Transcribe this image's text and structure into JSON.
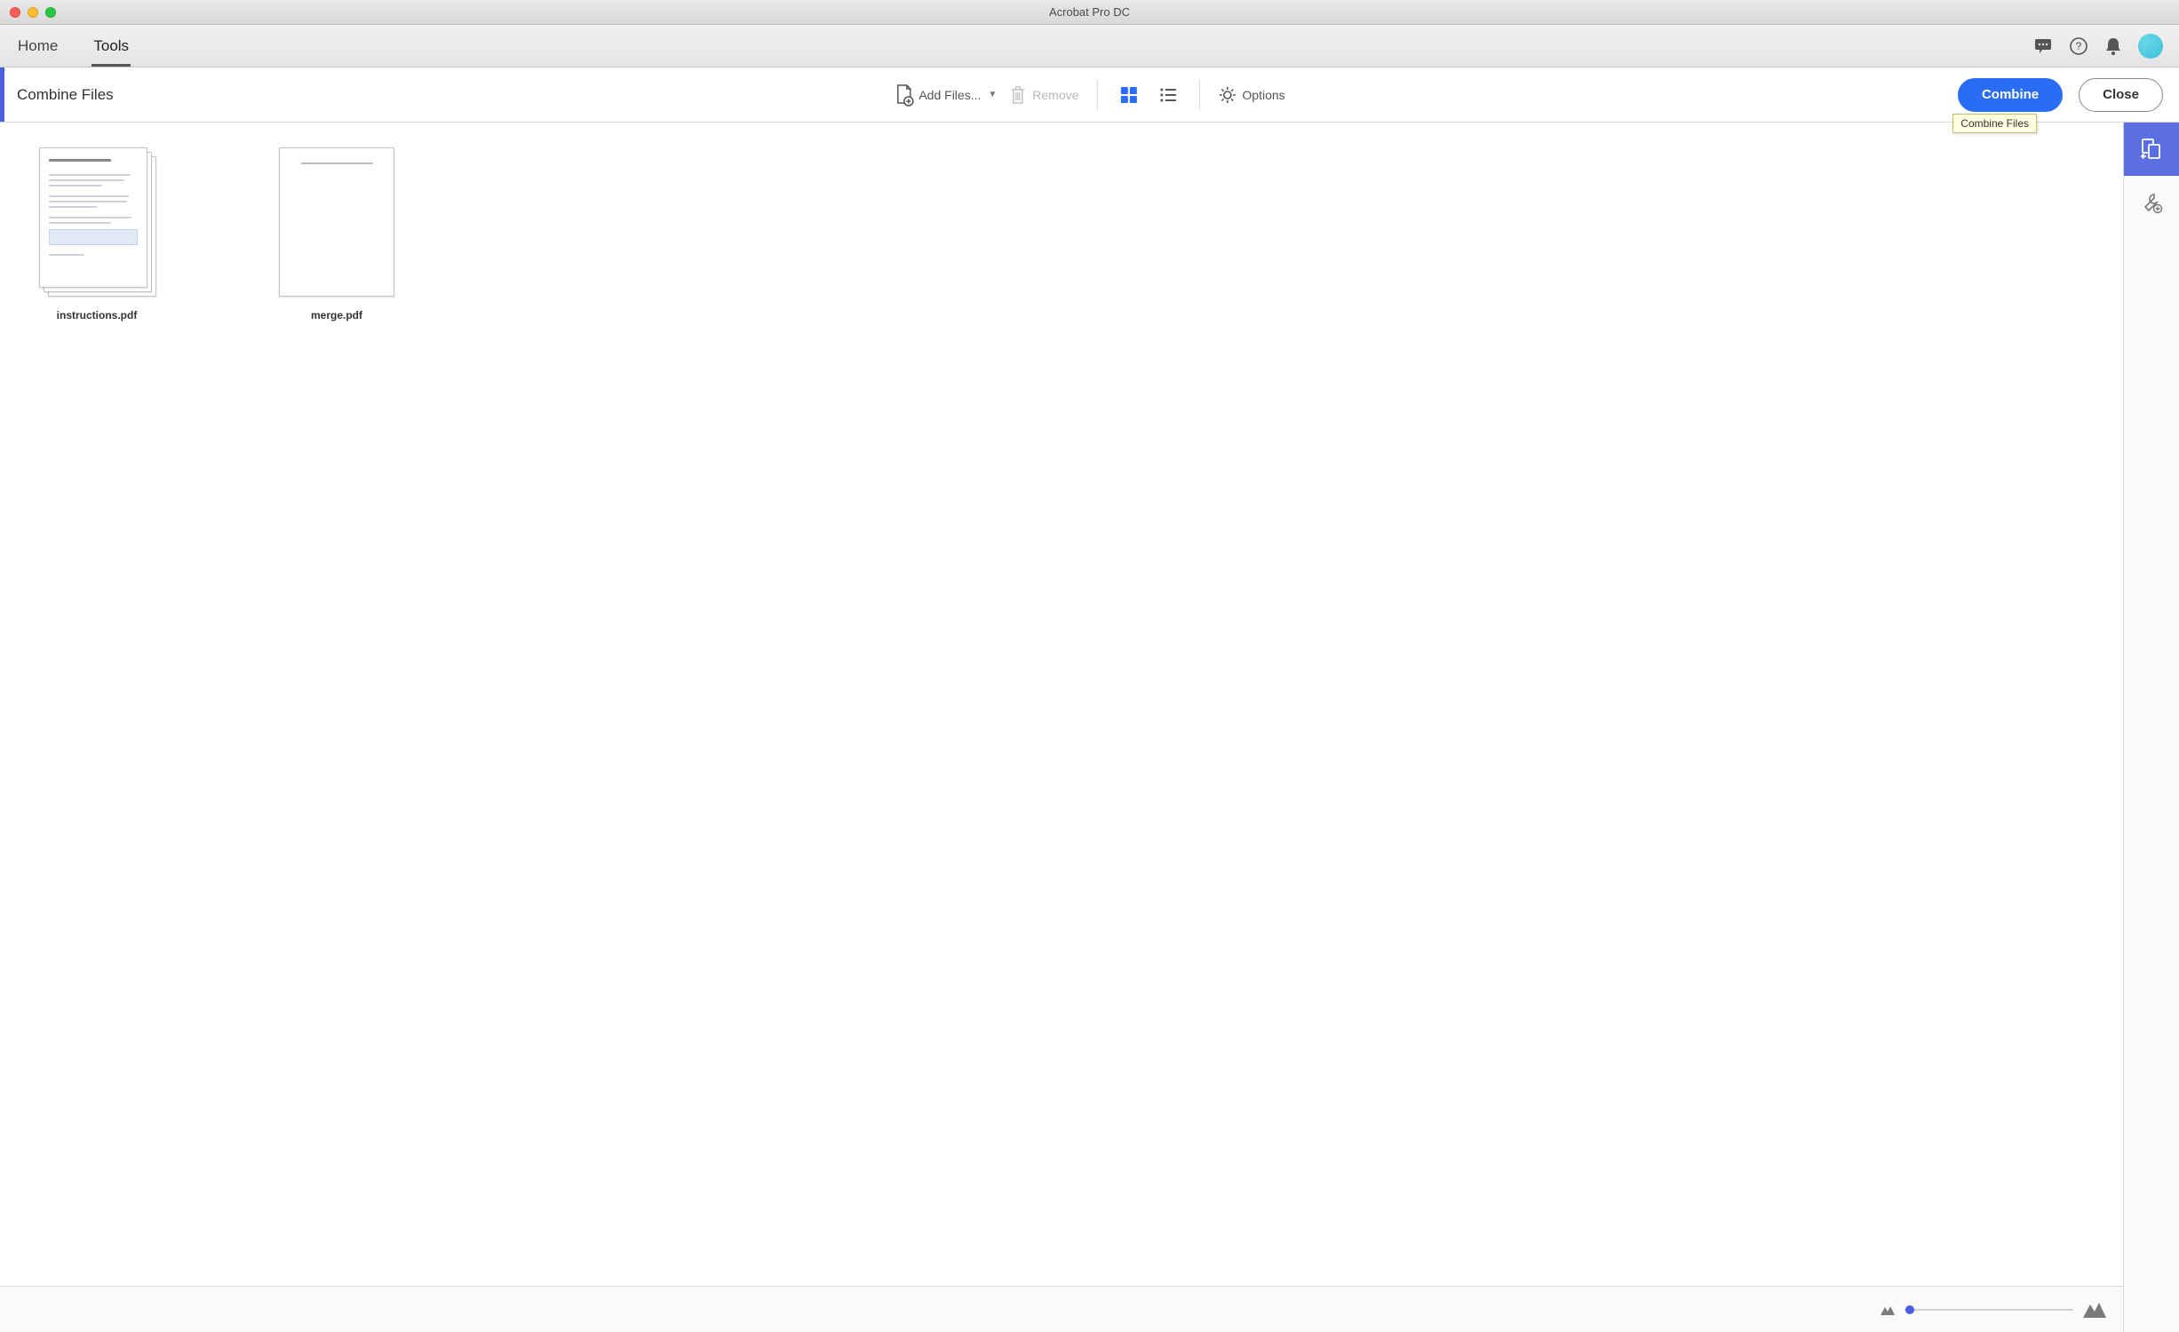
{
  "app": {
    "title": "Acrobat Pro DC"
  },
  "tabs": {
    "home": "Home",
    "tools": "Tools",
    "active": "tools"
  },
  "toolbar": {
    "title": "Combine Files",
    "add_files": "Add Files...",
    "remove": "Remove",
    "options": "Options",
    "combine": "Combine",
    "close": "Close"
  },
  "tooltip": {
    "combine_files": "Combine Files"
  },
  "files": [
    {
      "name": "instructions.pdf",
      "multipage": true
    },
    {
      "name": "merge.pdf",
      "multipage": false
    }
  ]
}
